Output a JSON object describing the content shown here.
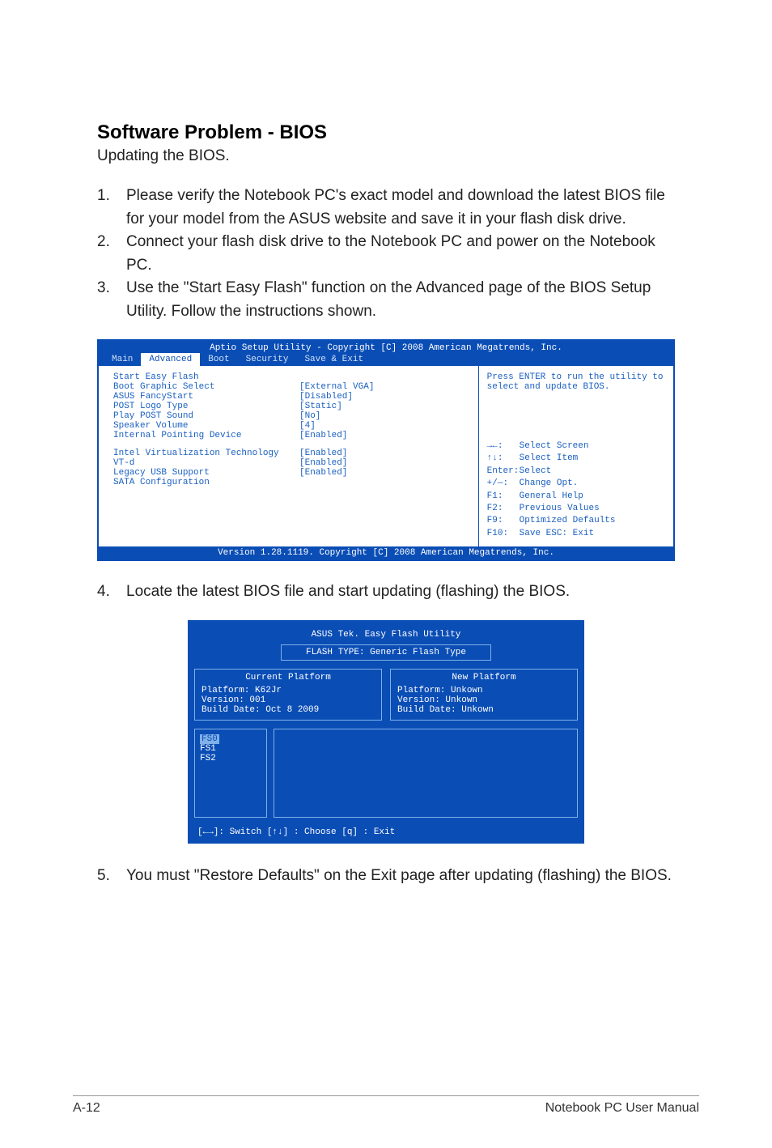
{
  "heading": "Software Problem - BIOS",
  "subheading": "Updating the BIOS.",
  "steps": {
    "s1": {
      "num": "1.",
      "txt": "Please verify the Notebook PC's exact model and download the latest BIOS file for your model from the ASUS website and save it in your flash disk drive."
    },
    "s2": {
      "num": "2.",
      "txt": "Connect your flash disk drive to the Notebook PC and power on the Notebook PC."
    },
    "s3": {
      "num": "3.",
      "txt": "Use the \"Start Easy Flash\" function on the Advanced page of the BIOS Setup Utility. Follow the instructions shown."
    },
    "s4": {
      "num": "4.",
      "txt": "Locate the latest BIOS file and start updating (flashing) the BIOS."
    },
    "s5": {
      "num": "5.",
      "txt": "You must \"Restore Defaults\" on the Exit page after updating (flashing) the BIOS."
    }
  },
  "bios": {
    "header": "Aptio Setup Utility - Copyright [C] 2008 American Megatrends, Inc.",
    "tabs": {
      "main": "Main",
      "advanced": "Advanced",
      "boot": "Boot",
      "security": "Security",
      "save": "Save & Exit"
    },
    "rows": {
      "r1": {
        "k": "Start Easy Flash",
        "v": ""
      },
      "r2": {
        "k": "Boot Graphic Select",
        "v": "[External VGA]"
      },
      "r3": {
        "k": "ASUS FancyStart",
        "v": "[Disabled]"
      },
      "r4": {
        "k": "POST Logo Type",
        "v": "[Static]"
      },
      "r5": {
        "k": "Play POST Sound",
        "v": "[No]"
      },
      "r6": {
        "k": "Speaker Volume",
        "v": "[4]"
      },
      "r7": {
        "k": "Internal Pointing Device",
        "v": "[Enabled]"
      },
      "r8": {
        "k": "Intel Virtualization Technology",
        "v": "[Enabled]"
      },
      "r9": {
        "k": "VT-d",
        "v": "[Enabled]"
      },
      "r10": {
        "k": "Legacy USB Support",
        "v": "[Enabled]"
      },
      "r11": {
        "k": "SATA Configuration",
        "v": ""
      }
    },
    "help_top": "Press ENTER to run the utility to select and update BIOS.",
    "help": {
      "h1": {
        "k": "→←:",
        "v": "Select Screen"
      },
      "h2": {
        "k": "↑↓:",
        "v": "Select Item"
      },
      "h3": {
        "k": "Enter:",
        "v": "Select"
      },
      "h4": {
        "k": "+/—:",
        "v": "Change Opt."
      },
      "h5": {
        "k": "F1:",
        "v": "General Help"
      },
      "h6": {
        "k": "F2:",
        "v": "Previous Values"
      },
      "h7": {
        "k": "F9:",
        "v": "Optimized Defaults"
      },
      "h8": {
        "k": "F10:",
        "v": "Save   ESC: Exit"
      }
    },
    "footer": "Version 1.28.1119. Copyright [C] 2008 American Megatrends, Inc."
  },
  "flash": {
    "title": "ASUS Tek. Easy Flash Utility",
    "flashtype": "FLASH TYPE: Generic Flash Type",
    "current": {
      "title": "Current Platform",
      "platform": "Platform:   K62Jr",
      "version": "Version:    001",
      "build": "Build Date: Oct 8 2009"
    },
    "new": {
      "title": "New Platform",
      "platform": "Platform:   Unkown",
      "version": "Version:    Unkown",
      "build": "Build Date: Unkown"
    },
    "fs": {
      "fs0": "FS0",
      "fs1": "FS1",
      "fs2": "FS2"
    },
    "footer": "[←→]: Switch   [↑↓] : Choose   [q] : Exit"
  },
  "footer": {
    "left": "A-12",
    "right": "Notebook PC User Manual"
  }
}
